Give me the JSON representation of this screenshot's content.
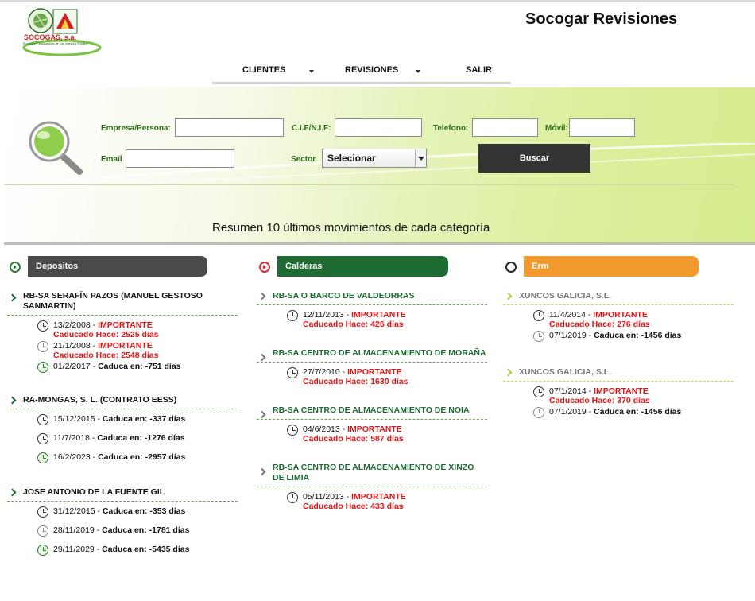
{
  "header": {
    "logo_text": "SOCOGAS, s.a.",
    "logo_sub": "Proyectos e Instalaciones de Gas Natural y Propano",
    "app_title": "Socogar Revisiones"
  },
  "nav": {
    "items": [
      {
        "label": "CLIENTES",
        "dropdown": true
      },
      {
        "label": "REVISIONES",
        "dropdown": true
      },
      {
        "label": "SALIR",
        "dropdown": false
      }
    ]
  },
  "search": {
    "labels": {
      "empresa": "Empresa/Persona:",
      "cif": "C.I.F/N.I.F:",
      "telefono": "Telefono:",
      "movil": "Móvil:",
      "email": "Email",
      "sector": "Sector"
    },
    "values": {
      "empresa": "",
      "cif": "",
      "telefono": "",
      "movil": "",
      "email": ""
    },
    "sector_selected": "Selecionar",
    "button": "Buscar"
  },
  "summary_title": "Resumen 10 últimos movimientos de cada categoría",
  "columns": [
    {
      "title": "Depositos",
      "groups": [
        {
          "name": "RB-SA SERAFÍN PAZOS (MANUEL GESTOSO SANMARTIN)",
          "entries": [
            {
              "date": "13/2/2008",
              "status": "IMPORTANTE",
              "note": "Caducado Hace: 2525 días"
            },
            {
              "date": "21/1/2008",
              "status": "IMPORTANTE",
              "note": "Caducado Hace: 2548 días"
            },
            {
              "date": "01/2/2017",
              "note": "Caduca en: -751 días"
            }
          ]
        },
        {
          "name": "RA-MONGAS, S. L. (CONTRATO EESS)",
          "entries": [
            {
              "date": "15/12/2015",
              "note": "Caduca en: -337 días"
            },
            {
              "date": "11/7/2018",
              "note": "Caduca en: -1276 días"
            },
            {
              "date": "16/2/2023",
              "note": "Caduca en: -2957 días"
            }
          ]
        },
        {
          "name": "JOSE ANTONIO DE LA FUENTE GIL",
          "entries": [
            {
              "date": "31/12/2015",
              "note": "Caduca en: -353 días"
            },
            {
              "date": "28/11/2019",
              "note": "Caduca en: -1781 días"
            },
            {
              "date": "29/11/2029",
              "note": "Caduca en: -5435 días"
            }
          ]
        }
      ]
    },
    {
      "title": "Calderas",
      "groups": [
        {
          "name": "RB-SA O BARCO DE VALDEORRAS",
          "entries": [
            {
              "date": "12/11/2013",
              "status": "IMPORTANTE",
              "note": "Caducado Hace: 426 días"
            }
          ]
        },
        {
          "name": "RB-SA CENTRO DE ALMACENAMIENTO DE MORAÑA",
          "entries": [
            {
              "date": "27/7/2010",
              "status": "IMPORTANTE",
              "note": "Caducado Hace: 1630 días"
            }
          ]
        },
        {
          "name": "RB-SA CENTRO DE ALMACENAMIENTO DE NOIA",
          "entries": [
            {
              "date": "04/6/2013",
              "status": "IMPORTANTE",
              "note": "Caducado Hace: 587 días"
            }
          ]
        },
        {
          "name": "RB-SA CENTRO DE ALMACENAMIENTO DE XINZO DE LIMIA",
          "entries": [
            {
              "date": "05/11/2013",
              "status": "IMPORTANTE",
              "note": "Caducado Hace: 433 días"
            }
          ]
        }
      ]
    },
    {
      "title": "Erm",
      "groups": [
        {
          "name": "XUNCOS GALICIA, S.L.",
          "entries": [
            {
              "date": "11/4/2014",
              "status": "IMPORTANTE",
              "note": "Caducado Hace: 276 días"
            },
            {
              "date": "07/1/2019",
              "note": "Caduca en: -1456 días"
            }
          ]
        },
        {
          "name": "XUNCOS GALICIA, S.L.",
          "entries": [
            {
              "date": "07/1/2014",
              "status": "IMPORTANTE",
              "note": "Caducado Hace: 370 días"
            },
            {
              "date": "07/1/2019",
              "note": "Caduca en: -1456 días"
            }
          ]
        }
      ]
    }
  ],
  "colors": {
    "accent_green": "#1f6b33",
    "tab_dark": "#4a4a4a",
    "tab_orange": "#f29a2e",
    "alert_red": "#e01515",
    "button_dark": "#333333"
  }
}
